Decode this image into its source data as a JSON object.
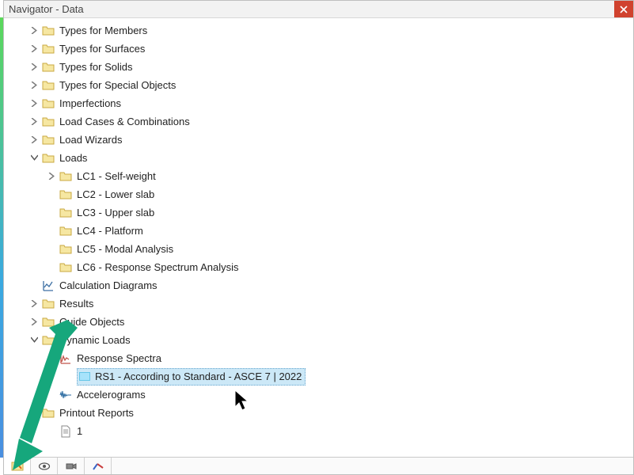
{
  "window": {
    "title": "Navigator - Data"
  },
  "tree": {
    "types_members": "Types for Members",
    "types_surfaces": "Types for Surfaces",
    "types_solids": "Types for Solids",
    "types_special": "Types for Special Objects",
    "imperfections": "Imperfections",
    "load_cases": "Load Cases & Combinations",
    "load_wizards": "Load Wizards",
    "loads": "Loads",
    "lc1": "LC1 - Self-weight",
    "lc2": "LC2 - Lower slab",
    "lc3": "LC3 - Upper slab",
    "lc4": "LC4 - Platform",
    "lc5": "LC5 - Modal Analysis",
    "lc6": "LC6 - Response Spectrum Analysis",
    "calc_diagrams": "Calculation Diagrams",
    "results": "Results",
    "guide_objects": "Guide Objects",
    "dynamic_loads": "Dynamic Loads",
    "response_spectra": "Response Spectra",
    "rs1": "RS1 - According to Standard - ASCE 7 | 2022",
    "accelerograms": "Accelerograms",
    "printout_reports": "Printout Reports",
    "report1": "1"
  },
  "colors": {
    "folder_fill": "#f6e7a2",
    "folder_stroke": "#c9a942"
  }
}
